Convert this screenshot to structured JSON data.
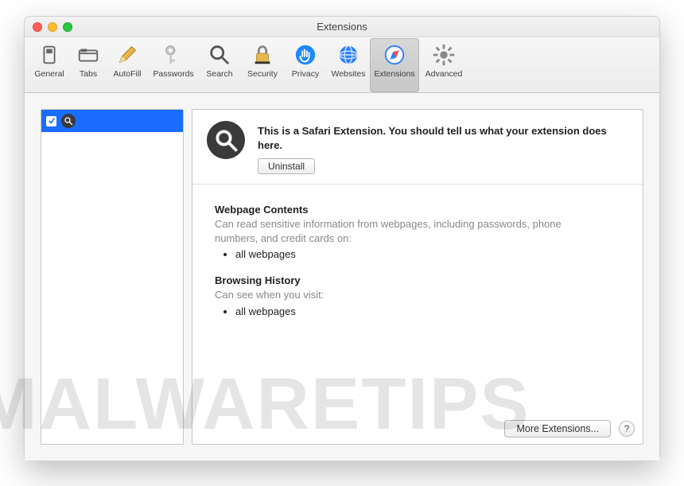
{
  "window": {
    "title": "Extensions"
  },
  "toolbar": {
    "items": [
      {
        "label": "General"
      },
      {
        "label": "Tabs"
      },
      {
        "label": "AutoFill"
      },
      {
        "label": "Passwords"
      },
      {
        "label": "Search"
      },
      {
        "label": "Security"
      },
      {
        "label": "Privacy"
      },
      {
        "label": "Websites"
      },
      {
        "label": "Extensions"
      },
      {
        "label": "Advanced"
      }
    ]
  },
  "sidebar": {
    "selected_item": {
      "name": ""
    }
  },
  "detail": {
    "description": "This is a Safari Extension. You should tell us what your extension does here.",
    "uninstall_label": "Uninstall",
    "permissions": [
      {
        "title": "Webpage Contents",
        "description": "Can read sensitive information from webpages, including passwords, phone numbers, and credit cards on:",
        "items": [
          "all webpages"
        ]
      },
      {
        "title": "Browsing History",
        "description": "Can see when you visit:",
        "items": [
          "all webpages"
        ]
      }
    ]
  },
  "footer": {
    "more_label": "More Extensions...",
    "help_label": "?"
  },
  "watermark": "MALWARETIPS"
}
